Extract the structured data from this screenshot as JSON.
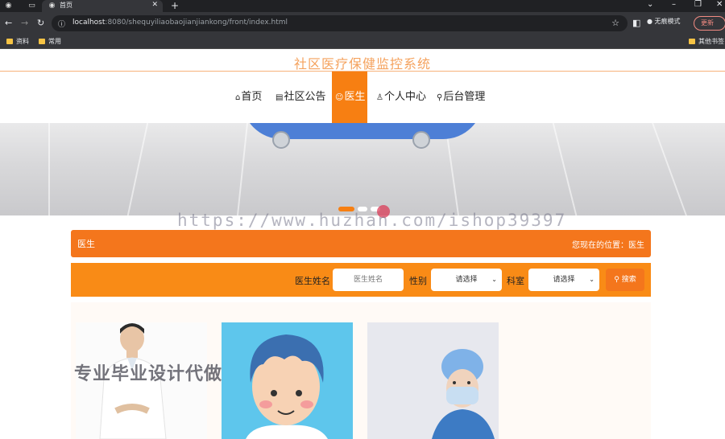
{
  "browser": {
    "tab_title": "首页",
    "url_host": "localhost",
    "url_rest": ":8080/shequyiliaobaojianjiankong/front/index.html",
    "incognito_label": "无痕模式",
    "update_label": "更新",
    "bookmarks": [
      "资料",
      "常用"
    ],
    "other_bookmarks": "其他书签"
  },
  "site": {
    "title": "社区医疗保健监控系统",
    "nav": [
      {
        "icon": "⌂",
        "label": "首页"
      },
      {
        "icon": "▤",
        "label": "社区公告"
      },
      {
        "icon": "☺",
        "label": "医生"
      },
      {
        "icon": "♙",
        "label": "个人中心"
      },
      {
        "icon": "⚲",
        "label": "后台管理"
      }
    ],
    "active_nav": 2
  },
  "watermark": "https://www.huzhan.com/ishop39397",
  "overlay_text": "专业毕业设计代做",
  "breadcrumb": {
    "title": "医生",
    "location": "您现在的位置：医生"
  },
  "search": {
    "name_label": "医生姓名",
    "name_placeholder": "医生姓名",
    "gender_label": "性别",
    "gender_value": "请选择",
    "dept_label": "科室",
    "dept_value": "请选择",
    "button_label": "搜索"
  },
  "colors": {
    "accent": "#f77f12",
    "title": "#f5a25d"
  }
}
